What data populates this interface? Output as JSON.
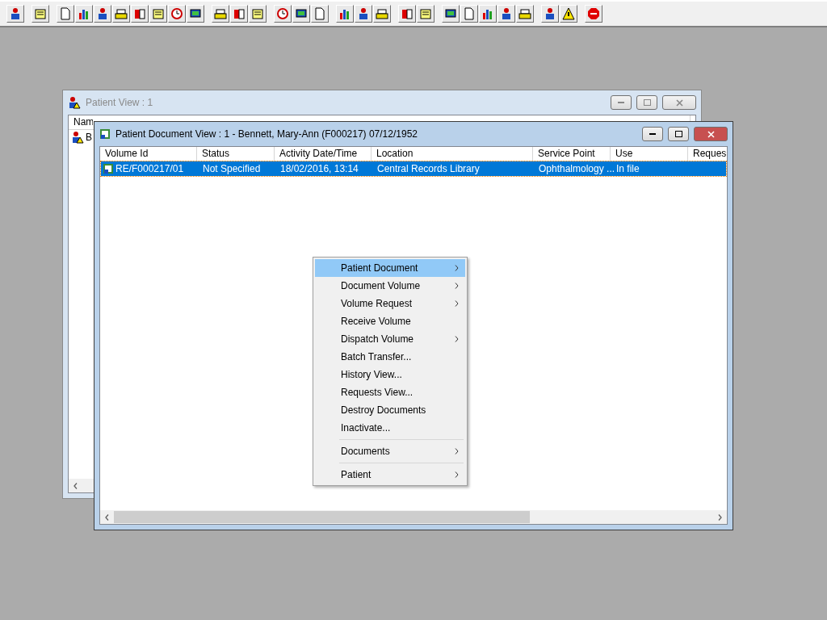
{
  "back_window": {
    "title": "Patient View : 1",
    "active": false,
    "columns": [
      {
        "label": "Nam"
      }
    ],
    "rows": [
      {
        "cells": [
          "B"
        ]
      }
    ]
  },
  "front_window": {
    "title": "Patient Document View : 1 - Bennett, Mary-Ann (F000217) 07/12/1952",
    "active": true,
    "columns": [
      {
        "label": "Volume Id"
      },
      {
        "label": "Status"
      },
      {
        "label": "Activity Date/Time"
      },
      {
        "label": "Location"
      },
      {
        "label": "Service Point"
      },
      {
        "label": "Use"
      },
      {
        "label": "Reques"
      }
    ],
    "rows": [
      {
        "selected": true,
        "cells": [
          "RE/F000217/01",
          "Not Specified",
          "18/02/2016, 13:14",
          "Central Records Library",
          "Ophthalmology ...",
          "In file",
          ""
        ]
      }
    ]
  },
  "context_menu": {
    "items": [
      {
        "label": "Patient Document",
        "submenu": true,
        "selected": true
      },
      {
        "label": "Document Volume",
        "submenu": true,
        "selected": false
      },
      {
        "label": "Volume Request",
        "submenu": true,
        "selected": false
      },
      {
        "label": "Receive Volume",
        "submenu": false,
        "selected": false
      },
      {
        "label": "Dispatch Volume",
        "submenu": true,
        "selected": false
      },
      {
        "label": "Batch Transfer...",
        "submenu": false,
        "selected": false
      },
      {
        "label": "History View...",
        "submenu": false,
        "selected": false
      },
      {
        "label": "Requests View...",
        "submenu": false,
        "selected": false
      },
      {
        "label": "Destroy Documents",
        "submenu": false,
        "selected": false
      },
      {
        "label": "Inactivate...",
        "submenu": false,
        "selected": false
      },
      {
        "kind": "separator"
      },
      {
        "label": "Documents",
        "submenu": true,
        "selected": false
      },
      {
        "kind": "separator"
      },
      {
        "label": "Patient",
        "submenu": true,
        "selected": false
      }
    ]
  }
}
